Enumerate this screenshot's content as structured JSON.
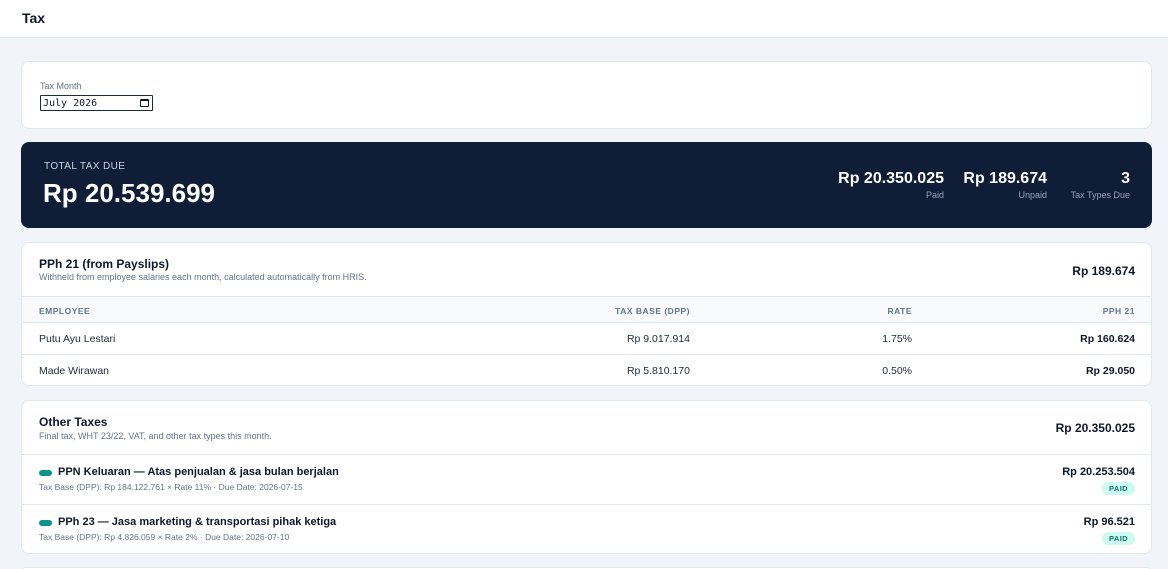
{
  "page": {
    "title": "Tax"
  },
  "filter": {
    "label": "Tax Month",
    "value": "July 2026"
  },
  "summary": {
    "total_label": "TOTAL TAX DUE",
    "total_value": "Rp 20.539.699",
    "paid_value": "Rp 20.350.025",
    "paid_label": "Paid",
    "unpaid_value": "Rp 189.674",
    "unpaid_label": "Unpaid",
    "types_value": "3",
    "types_label": "Tax Types Due"
  },
  "pph21": {
    "title": "PPh 21 (from Payslips)",
    "subtitle": "Withheld from employee salaries each month, calculated automatically from HRIS.",
    "total": "Rp 189.674",
    "columns": [
      "EMPLOYEE",
      "TAX BASE (DPP)",
      "RATE",
      "PPH 21"
    ],
    "rows": [
      {
        "employee": "Putu Ayu Lestari",
        "base": "Rp 9.017.914",
        "rate": "1.75%",
        "pph": "Rp 160.624"
      },
      {
        "employee": "Made Wirawan",
        "base": "Rp 5.810.170",
        "rate": "0.50%",
        "pph": "Rp 29.050"
      }
    ]
  },
  "other": {
    "title": "Other Taxes",
    "subtitle": "Final tax, WHT 23/22, VAT, and other tax types this month.",
    "total": "Rp 20.350.025",
    "items": [
      {
        "name": "PPN Keluaran — Atas penjualan & jasa bulan berjalan",
        "meta": "Tax Base (DPP): Rp 184.122.761 × Rate 11% · Due Date: 2026-07-15",
        "amount": "Rp 20.253.504",
        "status": "PAID"
      },
      {
        "name": "PPh 23 — Jasa marketing & transportasi pihak ketiga",
        "meta": "Tax Base (DPP): Rp 4.826.059 × Rate 2% · Due Date: 2026-07-10",
        "amount": "Rp 96.521",
        "status": "PAID"
      }
    ]
  },
  "colors": {
    "summary_bg": "#0f1e36",
    "status_dot": "#0d9488",
    "paid_badge_bg": "#ccfbf1",
    "paid_badge_text": "#0f766e"
  }
}
